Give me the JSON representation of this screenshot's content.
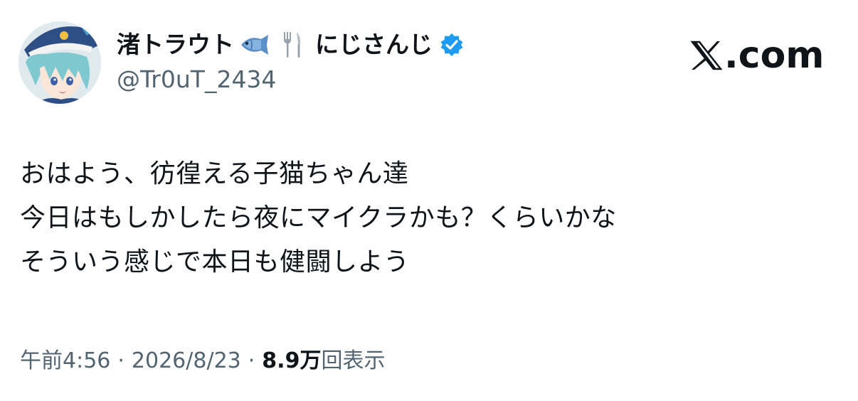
{
  "user": {
    "display_name": "渚トラウト",
    "affiliation": "にじさんじ",
    "handle": "@Tr0uT_2434",
    "verified": true,
    "name_emoji": [
      "fish-icon",
      "fork-and-knife-icon"
    ]
  },
  "brand": {
    "label": ".com",
    "logo": "x-logo-icon"
  },
  "tweet": {
    "lines": [
      "おはよう、彷徨える子猫ちゃん達",
      "今日はもしかしたら夜にマイクラかも？くらいかな",
      "そういう感じで本日も健闘しよう"
    ]
  },
  "meta": {
    "time": "午前4:56",
    "separator": "·",
    "date": "2026/8/23",
    "views_count": "8.9",
    "views_unit": "万",
    "views_label": "回表示"
  },
  "colors": {
    "text": "#0f1419",
    "secondary": "#536471",
    "verified_blue": "#1d9bf0"
  }
}
